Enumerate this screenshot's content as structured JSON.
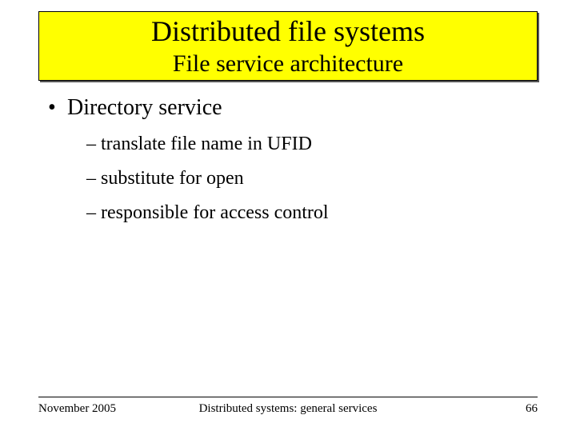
{
  "header": {
    "title": "Distributed file systems",
    "subtitle": "File service architecture"
  },
  "content": {
    "item": "Directory service",
    "subitems": [
      "translate file name in UFID",
      "substitute for open",
      "responsible for access control"
    ]
  },
  "footer": {
    "date": "November 2005",
    "center": "Distributed systems: general services",
    "page": "66"
  }
}
